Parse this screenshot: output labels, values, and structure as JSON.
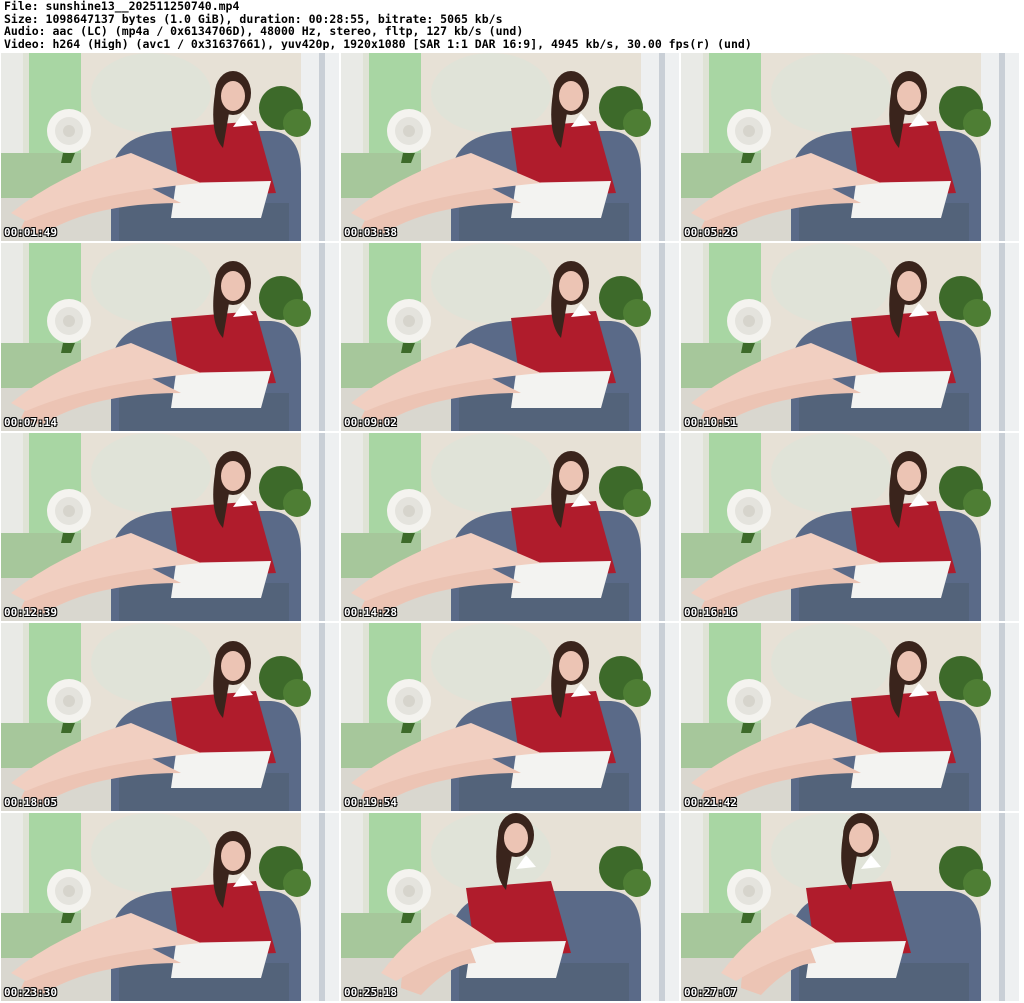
{
  "header": {
    "line1": "File: sunshine13__202511250740.mp4",
    "line2": "Size: 1098647137 bytes (1.0 GiB), duration: 00:28:55, bitrate: 5065 kb/s",
    "line3": "Audio: aac (LC) (mp4a / 0x6134706D), 48000 Hz, stereo, fltp, 127 kb/s (und)",
    "line4": "Video: h264 (High) (avc1 / 0x31637661), yuv420p, 1920x1080 [SAR 1:1 DAR 16:9], 4945 kb/s, 30.00 fps(r) (und)"
  },
  "colors": {
    "wall": "#e7e1d6",
    "curtain_green": "#9fd39a",
    "chair": "#5a6a88",
    "cushion": "#53637a",
    "sweater": "#b01c2c",
    "skirt": "#f3f3f1",
    "skin": "#ecc4b4",
    "hair": "#3a241c",
    "flower": "#f4f3ef",
    "plant": "#3d6a2a",
    "floor": "#d9d7cf"
  },
  "thumbnails": [
    {
      "time": "00:01:49",
      "icon": "video-frame-thumbnail"
    },
    {
      "time": "00:03:38",
      "icon": "video-frame-thumbnail"
    },
    {
      "time": "00:05:26",
      "icon": "video-frame-thumbnail"
    },
    {
      "time": "00:07:14",
      "icon": "video-frame-thumbnail"
    },
    {
      "time": "00:09:02",
      "icon": "video-frame-thumbnail"
    },
    {
      "time": "00:10:51",
      "icon": "video-frame-thumbnail"
    },
    {
      "time": "00:12:39",
      "icon": "video-frame-thumbnail"
    },
    {
      "time": "00:14:28",
      "icon": "video-frame-thumbnail"
    },
    {
      "time": "00:16:16",
      "icon": "video-frame-thumbnail"
    },
    {
      "time": "00:18:05",
      "icon": "video-frame-thumbnail"
    },
    {
      "time": "00:19:54",
      "icon": "video-frame-thumbnail"
    },
    {
      "time": "00:21:42",
      "icon": "video-frame-thumbnail"
    },
    {
      "time": "00:23:30",
      "icon": "video-frame-thumbnail"
    },
    {
      "time": "00:25:18",
      "icon": "video-frame-thumbnail"
    },
    {
      "time": "00:27:07",
      "icon": "video-frame-thumbnail"
    }
  ]
}
